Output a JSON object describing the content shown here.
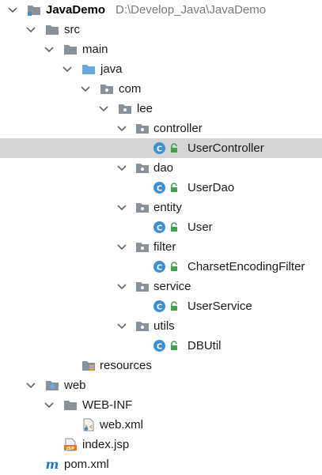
{
  "project": {
    "name": "JavaDemo",
    "path": "D:\\Develop_Java\\JavaDemo"
  },
  "nodes": {
    "src": "src",
    "main": "main",
    "java": "java",
    "com": "com",
    "lee": "lee",
    "controller": "controller",
    "usercontroller": "UserController",
    "dao": "dao",
    "userdao": "UserDao",
    "entity": "entity",
    "user": "User",
    "filter": "filter",
    "charsetfilter": "CharsetEncodingFilter",
    "service": "service",
    "userservice": "UserService",
    "utils": "utils",
    "dbutil": "DBUtil",
    "resources": "resources",
    "web": "web",
    "webinf": "WEB-INF",
    "webxml": "web.xml",
    "indexjsp": "index.jsp",
    "pomxml": "pom.xml"
  },
  "icon_labels": {
    "class_letter": "C",
    "jsp_badge": "JSP",
    "maven_letter": "m"
  },
  "colors": {
    "selected_row": "#d5d5d5",
    "folder": "#8a9199",
    "source_folder": "#6aa9e0",
    "class_circle": "#3d8fd1",
    "lock_green": "#3fa34d",
    "jsp_orange": "#e07a1f",
    "maven_blue": "#2474c5"
  }
}
